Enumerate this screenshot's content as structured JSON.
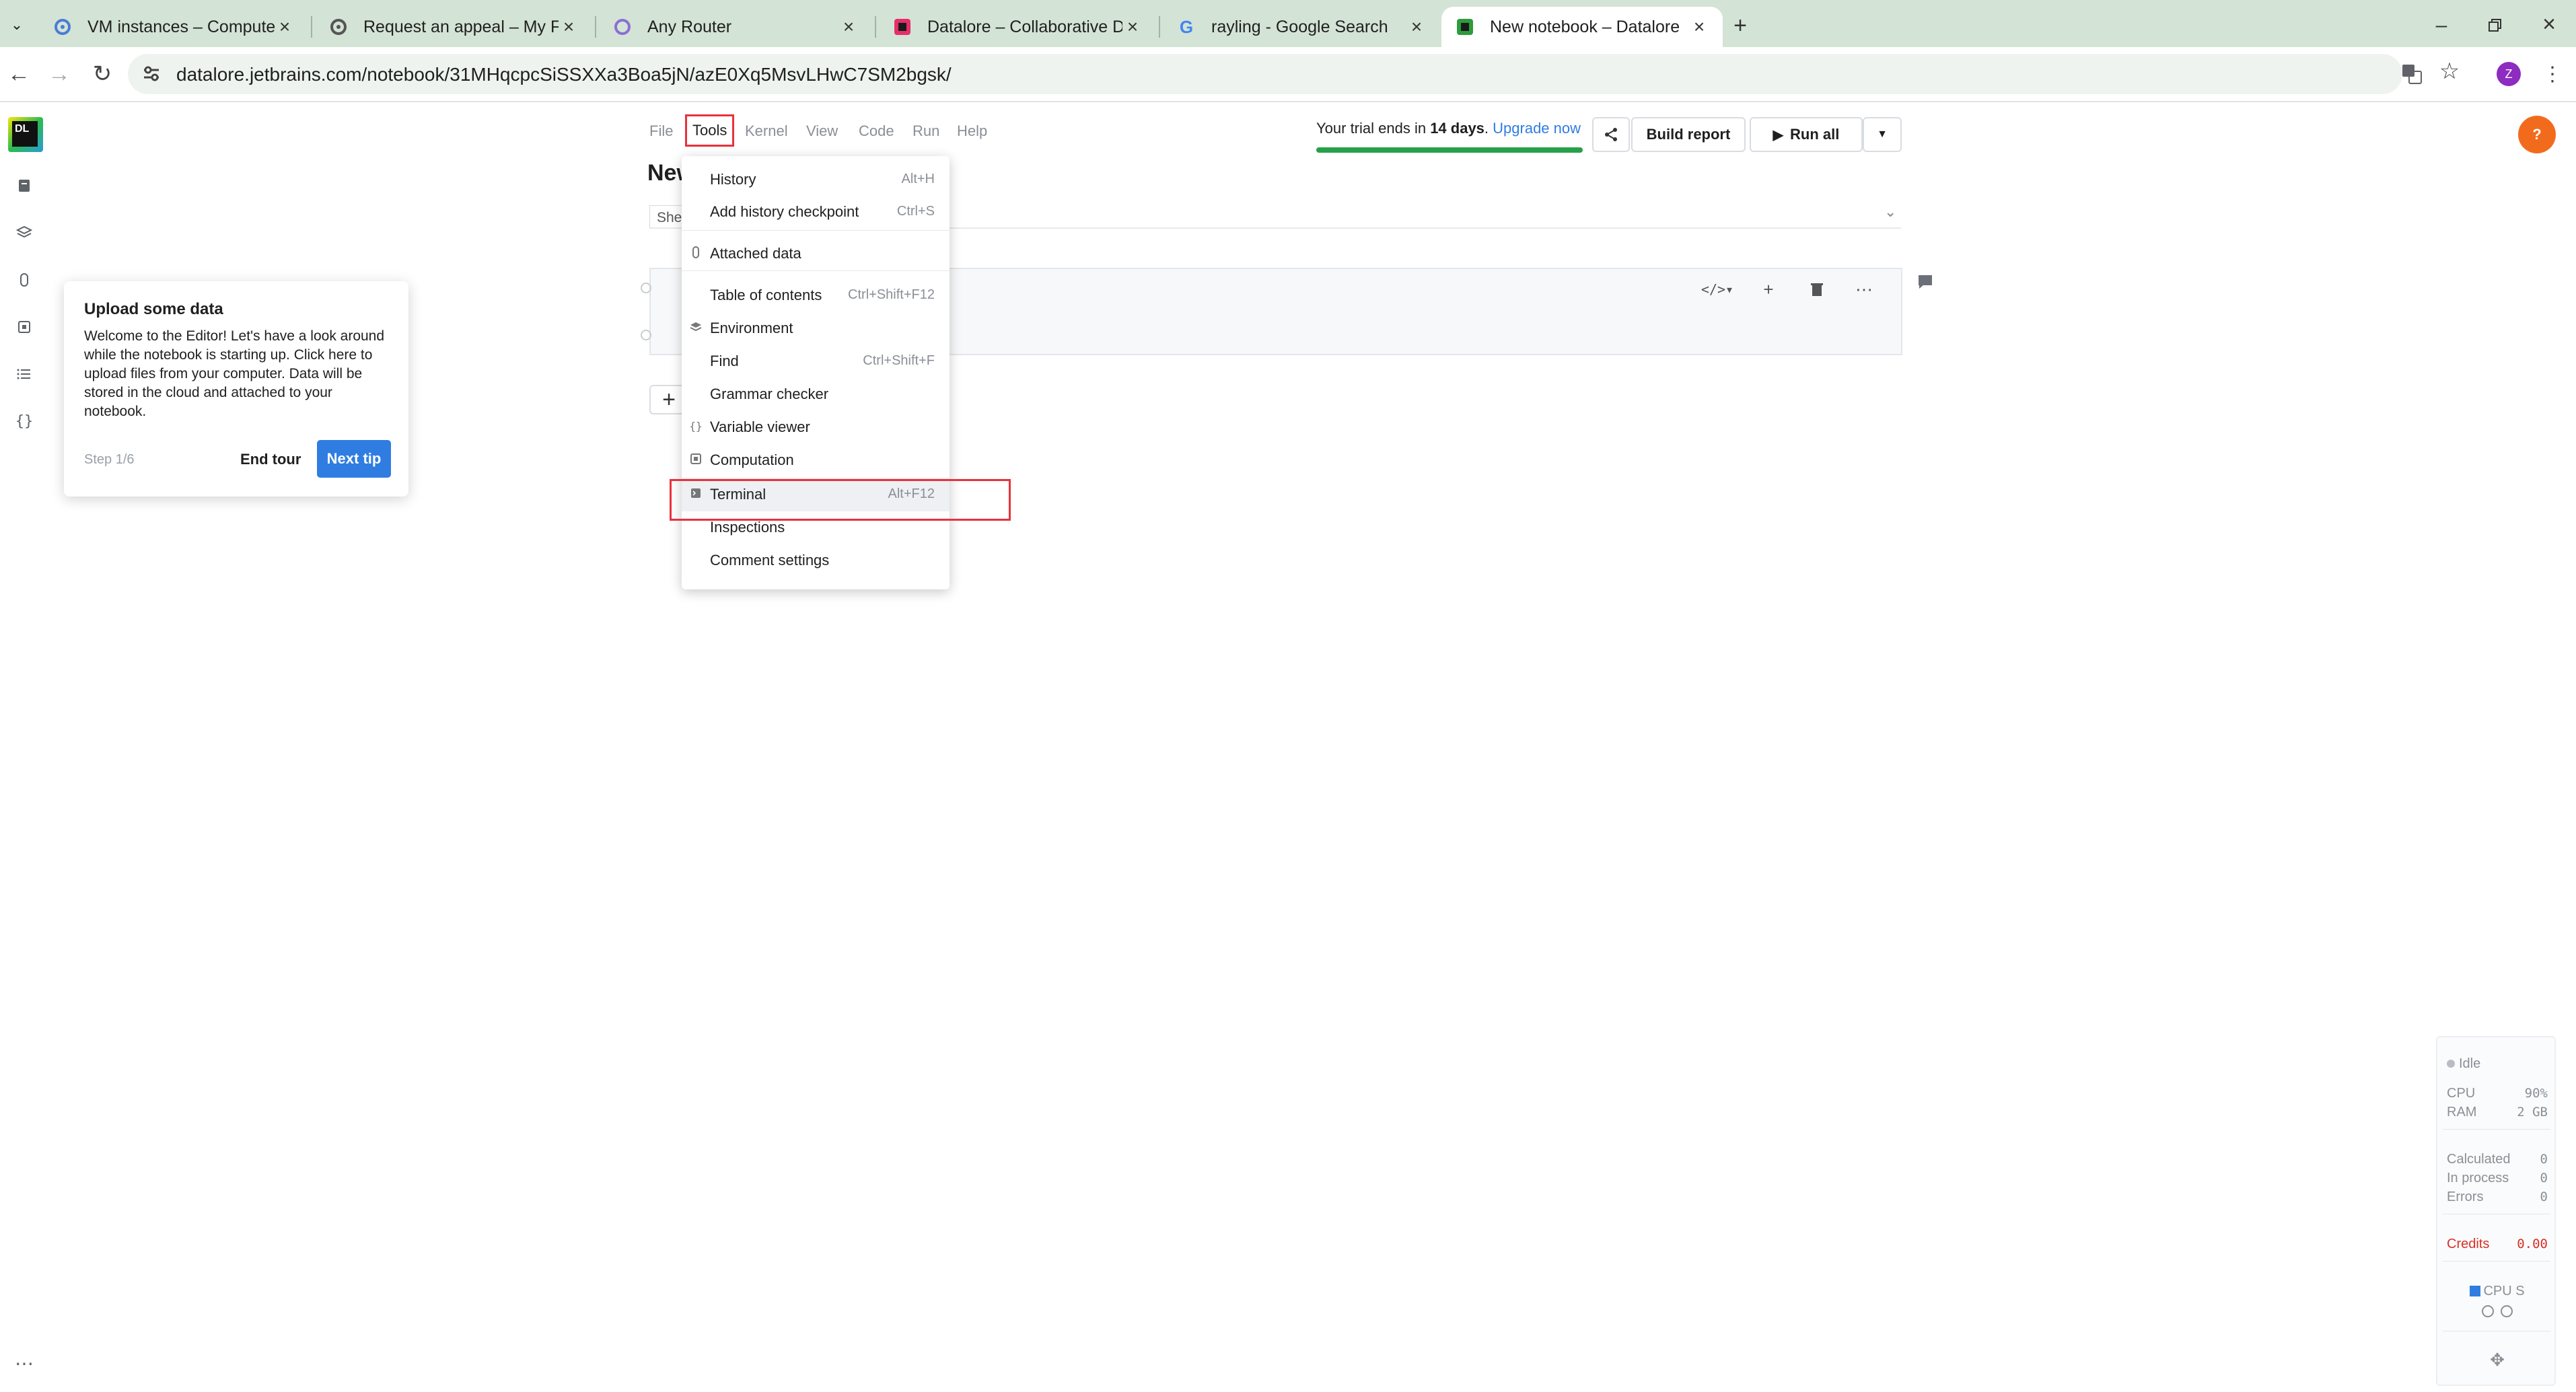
{
  "browser": {
    "tabs": [
      {
        "title": "VM instances – Compute Eng",
        "icon": "gear-icon"
      },
      {
        "title": "Request an appeal – My First",
        "icon": "gear-icon"
      },
      {
        "title": "Any Router",
        "icon": "router-icon"
      },
      {
        "title": "Datalore – Collaborative Data",
        "icon": "datalore-icon"
      },
      {
        "title": "rayling - Google Search",
        "icon": "google-icon"
      },
      {
        "title": "New notebook – Datalore",
        "icon": "datalore-icon"
      }
    ],
    "url": "datalore.jetbrains.com/notebook/31MHqcpcSiSSXXa3Boa5jN/azE0Xq5MsvLHwC7SM2bgsk/",
    "profile_initial": "Z"
  },
  "app": {
    "logo_text": "DL",
    "menu": [
      "File",
      "Tools",
      "Kernel",
      "View",
      "Code",
      "Run",
      "Help"
    ],
    "doc_title": "New notebook",
    "sheet_tab": "She",
    "trial": {
      "prefix": "Your trial ends in ",
      "days": "14 days",
      "suffix": ". ",
      "upgrade_link": "Upgrade now",
      "progress": 1.0
    },
    "build_report": "Build report",
    "run_all": "Run all",
    "help_icon": "?",
    "add_cell": "+"
  },
  "tools_menu": {
    "items": [
      {
        "label": "History",
        "shortcut": "Alt+H",
        "icon": ""
      },
      {
        "label": "Add history checkpoint",
        "shortcut": "Ctrl+S",
        "icon": ""
      },
      {
        "label": "Attached data",
        "shortcut": "",
        "icon": "paperclip-icon"
      },
      {
        "label": "Table of contents",
        "shortcut": "Ctrl+Shift+F12",
        "icon": ""
      },
      {
        "label": "Environment",
        "shortcut": "",
        "icon": "layers-icon"
      },
      {
        "label": "Find",
        "shortcut": "Ctrl+Shift+F",
        "icon": ""
      },
      {
        "label": "Grammar checker",
        "shortcut": "",
        "icon": ""
      },
      {
        "label": "Variable viewer",
        "shortcut": "",
        "icon": "braces-icon"
      },
      {
        "label": "Computation",
        "shortcut": "",
        "icon": "chip-icon"
      },
      {
        "label": "Terminal",
        "shortcut": "Alt+F12",
        "icon": "terminal-icon"
      },
      {
        "label": "Inspections",
        "shortcut": "",
        "icon": ""
      },
      {
        "label": "Comment settings",
        "shortcut": "",
        "icon": ""
      }
    ]
  },
  "tour": {
    "title": "Upload some data",
    "body": "Welcome to the Editor! Let's have a look around while the notebook is starting up. Click here to upload files from your computer. Data will be stored in the cloud and attached to your notebook.",
    "step": "Step 1/6",
    "end": "End tour",
    "next": "Next tip"
  },
  "status": {
    "state": "Idle",
    "cpu_label": "CPU",
    "cpu_value": "90%",
    "ram_label": "RAM",
    "ram_value": "2 GB",
    "calculated_label": "Calculated",
    "calculated_value": "0",
    "in_process_label": "In process",
    "in_process_value": "0",
    "errors_label": "Errors",
    "errors_value": "0",
    "credits_label": "Credits",
    "credits_value": "0.00",
    "machine": "CPU S",
    "colors": {
      "credits": "#d93025",
      "accent": "#2f7de1",
      "trial_bar": "#27a04a"
    }
  }
}
